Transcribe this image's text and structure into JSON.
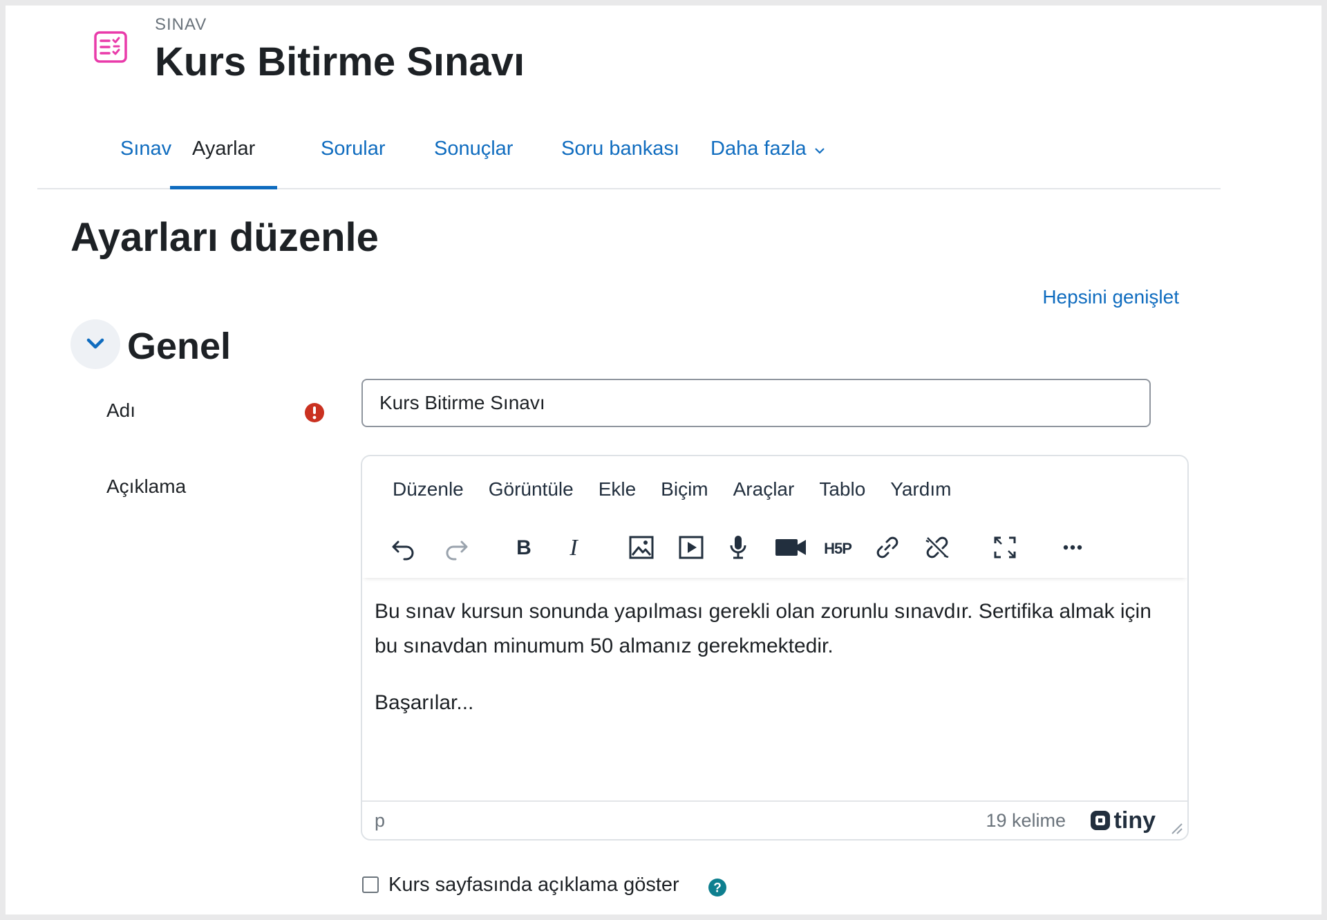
{
  "header": {
    "pretitle": "SINAV",
    "title": "Kurs Bitirme Sınavı",
    "icon": "quiz-icon",
    "icon_color": "#e93baa"
  },
  "tabs": [
    {
      "label": "Sınav",
      "active": false
    },
    {
      "label": "Ayarlar",
      "active": true
    },
    {
      "label": "Sorular",
      "active": false
    },
    {
      "label": "Sonuçlar",
      "active": false
    },
    {
      "label": "Soru bankası",
      "active": false
    },
    {
      "label": "Daha fazla",
      "active": false
    }
  ],
  "page": {
    "heading": "Ayarları düzenle",
    "expand_all": "Hepsini genişlet"
  },
  "section": {
    "title": "Genel"
  },
  "form": {
    "name_label": "Adı",
    "name_value": "Kurs Bitirme Sınavı",
    "description_label": "Açıklama",
    "show_description_label": "Kurs sayfasında açıklama göster",
    "show_description_checked": false
  },
  "editor": {
    "menu": [
      "Düzenle",
      "Görüntüle",
      "Ekle",
      "Biçim",
      "Araçlar",
      "Tablo",
      "Yardım"
    ],
    "toolbar_icons": [
      "undo-icon",
      "redo-icon",
      "bold-icon",
      "italic-icon",
      "image-icon",
      "media-icon",
      "audio-record-icon",
      "video-record-icon",
      "h5p-icon",
      "link-icon",
      "unlink-icon",
      "fullscreen-icon",
      "more-icon"
    ],
    "paragraphs": [
      "Bu sınav kursun sonunda yapılması gerekli olan zorunlu sınavdır. Sertifika almak için bu sınavdan minumum 50 almanız gerekmektedir.",
      "Başarılar..."
    ],
    "path": "p",
    "word_count": "19 kelime",
    "brand": "tiny"
  },
  "colors": {
    "link": "#0f6cbf",
    "required": "#ca3120",
    "help": "#0e7f8f"
  }
}
